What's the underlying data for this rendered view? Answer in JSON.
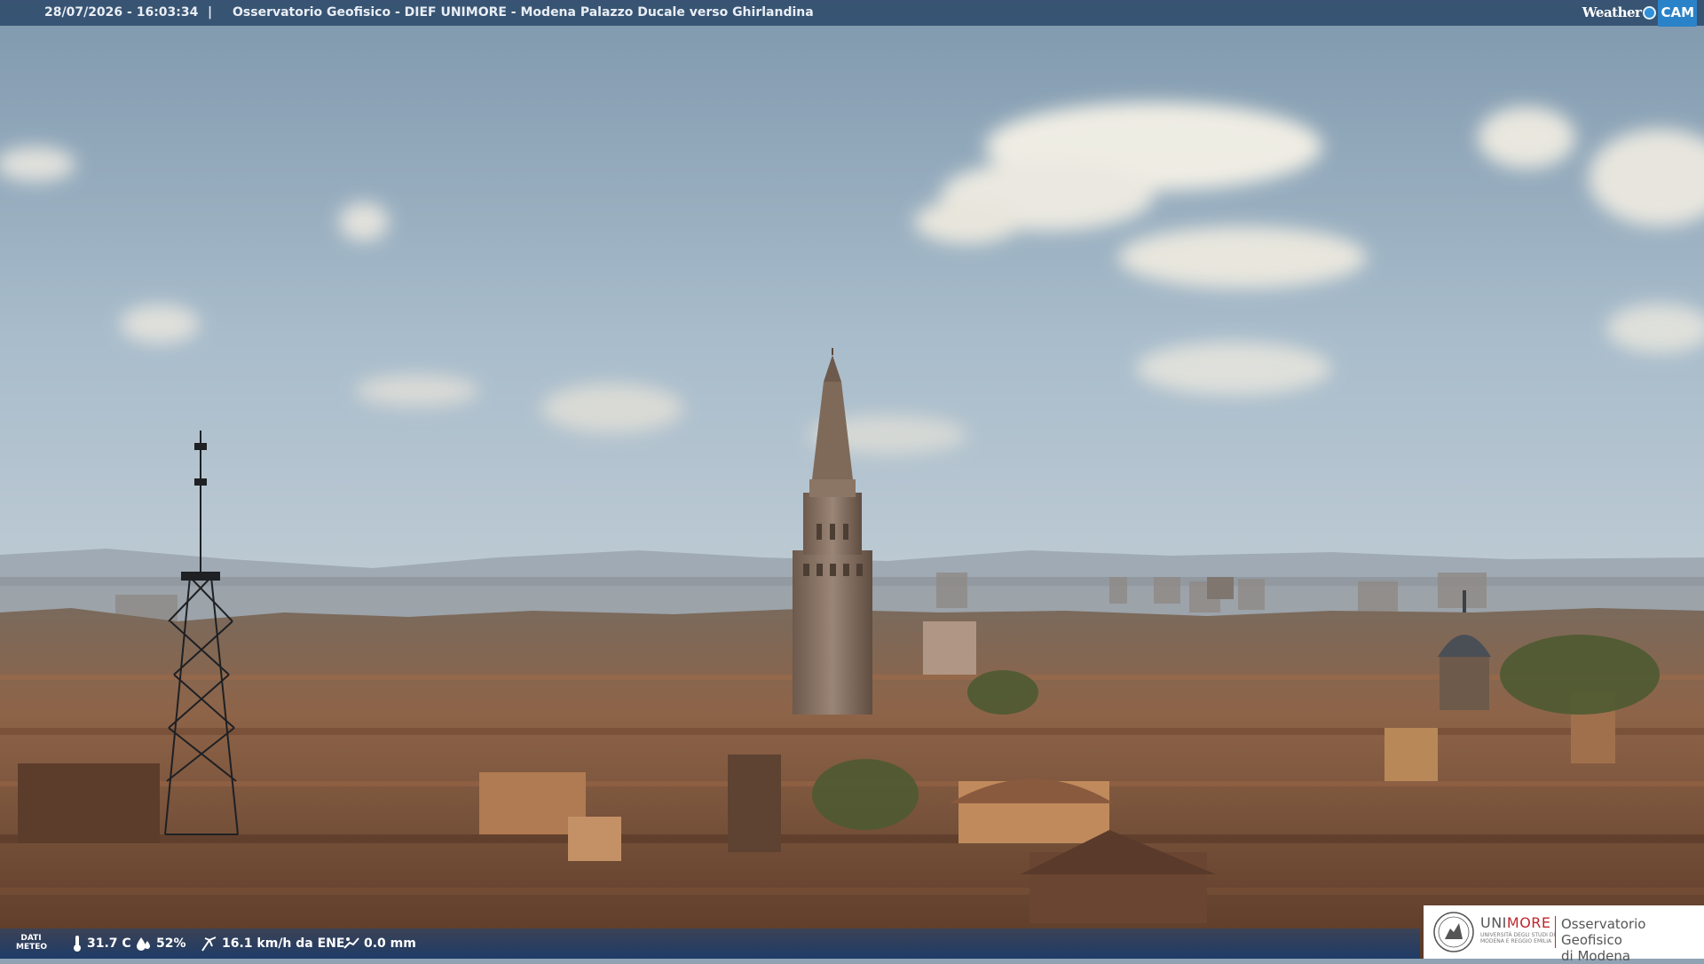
{
  "overlay": {
    "timestamp": "28/07/2026 - 16:03:34",
    "separator": "|",
    "caption": "Osservatorio Geofisico - DIEF UNIMORE - Modena Palazzo Ducale verso Ghirlandina",
    "brand": {
      "word": "Weather",
      "mark": "CAM"
    }
  },
  "weather": {
    "label_line1": "DATI",
    "label_line2": "METEO",
    "temperature": "31.7 C",
    "humidity": "52%",
    "wind": "16.1 km/h da ENE",
    "rain": "0.0 mm",
    "icons": [
      "thermometer-icon",
      "humidity-icon",
      "wind-icon",
      "rain-gauge-icon"
    ]
  },
  "logo": {
    "name_gray": "UNI",
    "name_red": "MORE",
    "subtitle": "UNIVERSITÀ DEGLI STUDI DI MODENA E REGGIO EMILIA",
    "observatory_line1": "Osservatorio Geofisico",
    "observatory_line2": "di Modena",
    "accent": "#c0272d"
  },
  "colors": {
    "topbar": "#284466",
    "bottombar": "#1e4678",
    "sky": "#a9bccb",
    "roofs": "#8a5a3c"
  }
}
